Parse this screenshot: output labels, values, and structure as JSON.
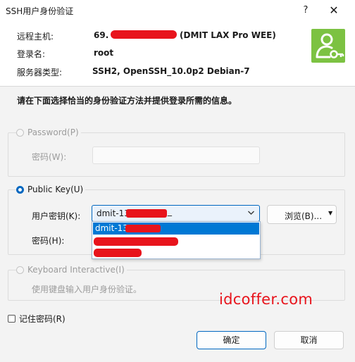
{
  "window": {
    "title": "SSH用户身份验证"
  },
  "titlebar": {
    "help": "?",
    "close": "✕"
  },
  "info": {
    "host_label": "远程主机:",
    "host_prefix": "69.",
    "host_suffix": "(DMIT LAX Pro WEE)",
    "login_label": "登录名:",
    "login_value": "root",
    "server_type_label": "服务器类型:",
    "server_type_value": "SSH2, OpenSSH_10.0p2 Debian-7"
  },
  "instruction": "请在下面选择恰当的身份验证方法并提供登录所需的信息。",
  "password_section": {
    "radio_label": "Password(P)",
    "field_label": "密码(W):",
    "value": ""
  },
  "publickey_section": {
    "radio_label": "Public Key(U)",
    "user_key_label": "用户密钥(K):",
    "selected_key": "dmit-13",
    "selected_key_tail": "_",
    "browse_button": "浏览(B)...",
    "passphrase_label": "密码(H):",
    "dropdown_items": [
      {
        "label": "dmit-13",
        "selected": true
      },
      {
        "label": "",
        "selected": false
      },
      {
        "label": "",
        "selected": false
      }
    ]
  },
  "keyboard_section": {
    "radio_label": "Keyboard Interactive(I)",
    "description": "使用键盘输入用户身份验证。"
  },
  "remember": {
    "label": "记住密码(R)",
    "checked": false
  },
  "watermark": "idcoffer.com",
  "buttons": {
    "ok": "确定",
    "cancel": "取消"
  },
  "colors": {
    "accent": "#0067c0",
    "selection": "#0078d4",
    "user_icon_bg": "#7cc242",
    "redaction": "#e8141c"
  },
  "icons": {
    "user_key": "user-key-icon",
    "chevron": "chevron-down-icon",
    "browse_dropdown": "caret-down-icon"
  }
}
